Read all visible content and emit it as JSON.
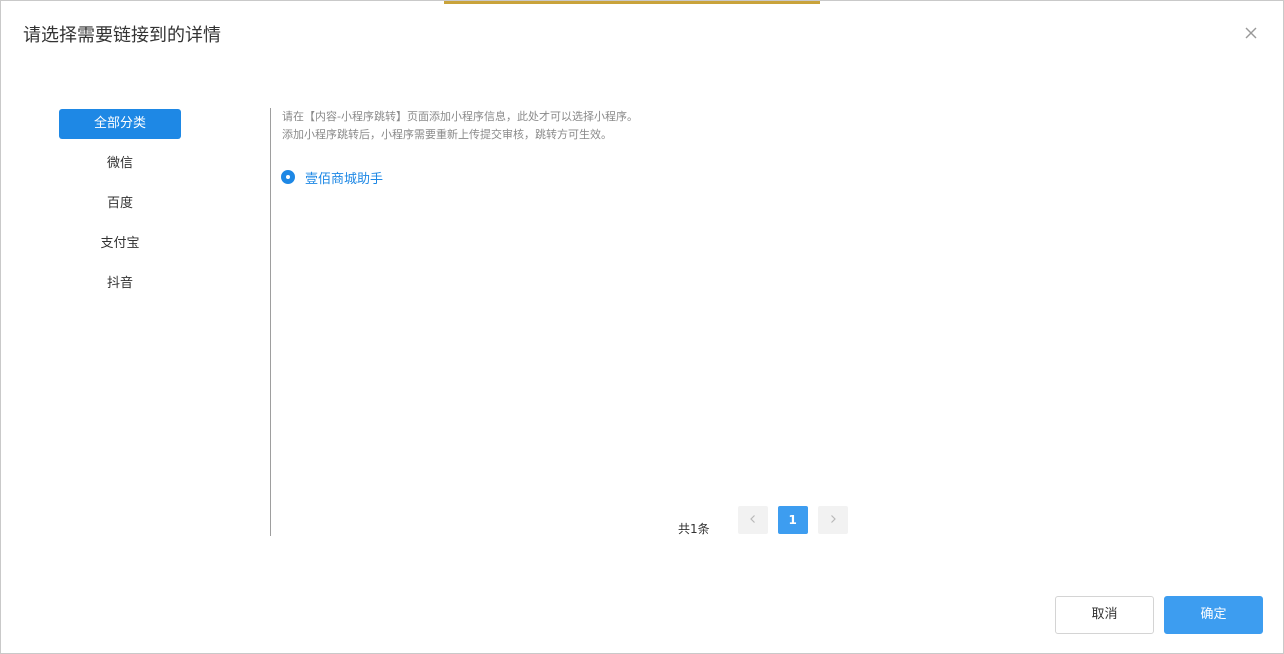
{
  "dialog": {
    "title": "请选择需要链接到的详情",
    "close_icon": "close-icon"
  },
  "sidebar": {
    "items": [
      {
        "label": "全部分类",
        "active": true
      },
      {
        "label": "微信",
        "active": false
      },
      {
        "label": "百度",
        "active": false
      },
      {
        "label": "支付宝",
        "active": false
      },
      {
        "label": "抖音",
        "active": false
      }
    ]
  },
  "main": {
    "hint_line_1": "请在【内容-小程序跳转】页面添加小程序信息，此处才可以选择小程序。",
    "hint_line_2": "添加小程序跳转后，小程序需要重新上传提交审核，跳转方可生效。",
    "options": [
      {
        "label": "壹佰商城助手",
        "selected": true
      }
    ]
  },
  "pagination": {
    "total": "共1条",
    "current_page": "1",
    "prev_icon": "chevron-left-icon",
    "next_icon": "chevron-right-icon"
  },
  "footer": {
    "cancel_label": "取消",
    "ok_label": "确定"
  },
  "colors": {
    "accent": "#1e88e5",
    "button_primary": "#3d9df0",
    "top_accent": "#c9a33b"
  }
}
